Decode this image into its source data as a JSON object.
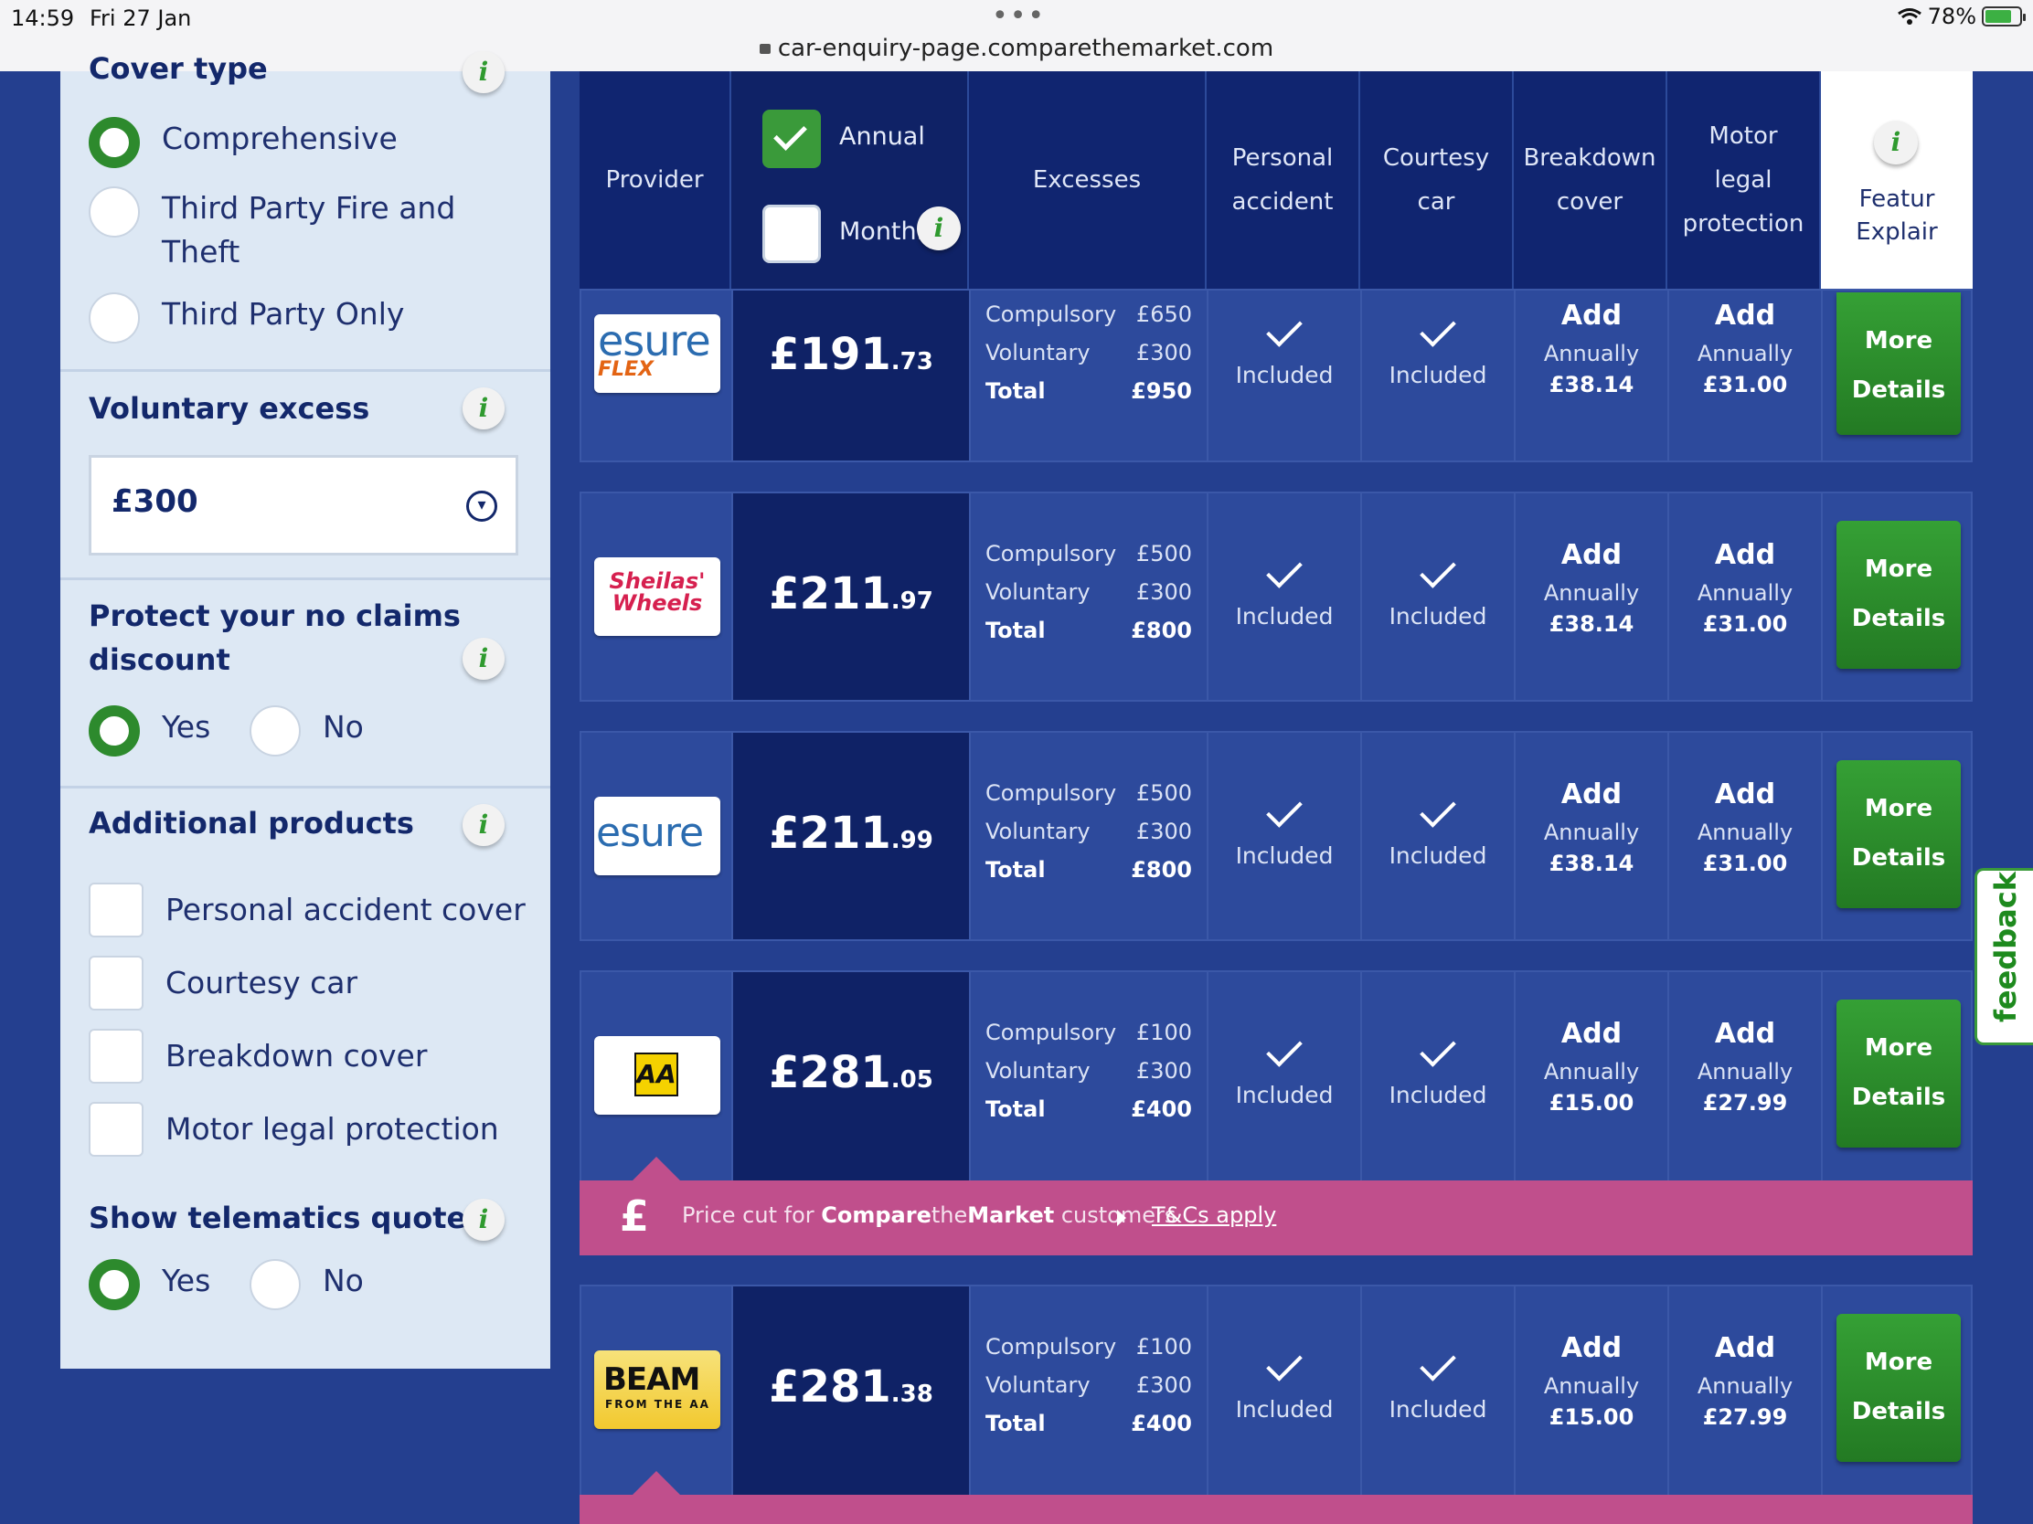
{
  "status_bar": {
    "time": "14:59",
    "date": "Fri 27 Jan",
    "battery": "78%",
    "url": "car-enquiry-page.comparethemarket.com"
  },
  "filters": {
    "cover_type": {
      "title": "Cover type",
      "options": [
        {
          "label": "Comprehensive",
          "selected": true
        },
        {
          "label": "Third Party Fire and\nTheft",
          "selected": false
        },
        {
          "label": "Third Party Only",
          "selected": false
        }
      ]
    },
    "voluntary_excess": {
      "title": "Voluntary excess",
      "value": "£300"
    },
    "no_claims": {
      "title": "Protect your no claims\ndiscount",
      "yes": "Yes",
      "no": "No",
      "selected": "Yes"
    },
    "additional_products": {
      "title": "Additional products",
      "items": [
        "Personal accident cover",
        "Courtesy car",
        "Breakdown cover",
        "Motor legal protection"
      ]
    },
    "telematics": {
      "title": "Show telematics quotes",
      "yes": "Yes",
      "no": "No",
      "selected": "Yes"
    },
    "info_glyph": "i"
  },
  "table_header": {
    "provider": "Provider",
    "annual": "Annual",
    "monthly": "Monthly",
    "excesses": "Excesses",
    "personal_accident": "Personal\naccident",
    "courtesy_car": "Courtesy\ncar",
    "breakdown_cover": "Breakdown\ncover",
    "motor_legal": "Motor\nlegal\nprotection",
    "feature": "Featur\nExplair"
  },
  "quotes": [
    {
      "provider": "esure FLEX",
      "price": "£191",
      "pence": ".73",
      "compulsory": "£650",
      "voluntary": "£300",
      "total": "£950",
      "breakdown": "£38.14",
      "legal": "£31.00"
    },
    {
      "provider": "Sheilas' Wheels",
      "price": "£211",
      "pence": ".97",
      "compulsory": "£500",
      "voluntary": "£300",
      "total": "£800",
      "breakdown": "£38.14",
      "legal": "£31.00"
    },
    {
      "provider": "esure",
      "price": "£211",
      "pence": ".99",
      "compulsory": "£500",
      "voluntary": "£300",
      "total": "£800",
      "breakdown": "£38.14",
      "legal": "£31.00"
    },
    {
      "provider": "AA",
      "price": "£281",
      "pence": ".05",
      "compulsory": "£100",
      "voluntary": "£300",
      "total": "£400",
      "breakdown": "£15.00",
      "legal": "£27.99"
    },
    {
      "provider": "BEAM FROM THE AA",
      "price": "£281",
      "pence": ".38",
      "compulsory": "£100",
      "voluntary": "£300",
      "total": "£400",
      "breakdown": "£15.00",
      "legal": "£27.99"
    }
  ],
  "row_labels": {
    "compulsory": "Compulsory",
    "voluntary": "Voluntary",
    "total": "Total",
    "included": "Included",
    "add": "Add",
    "annually": "Annually",
    "more_details": "More\nDetails"
  },
  "logos": {
    "esure": "esure",
    "flex": "FLEX",
    "sheilas_1": "Sheilas'",
    "sheilas_2": "Wheels",
    "aa": "AA",
    "beam": "BEAM",
    "beam_sub": "FROM THE AA"
  },
  "promo": {
    "pound": "£",
    "text_before": "Price cut for ",
    "brand_bold": "Compare",
    "brand_mid": "the",
    "brand_bold2": "Market",
    "text_after": " customers",
    "tcs": "T&Cs apply"
  },
  "feedback": "feedback",
  "colors": {
    "page_bg": "#243f8f",
    "header_bg": "#102570",
    "green": "#2d8a2d",
    "promo": "#c04f8c"
  }
}
